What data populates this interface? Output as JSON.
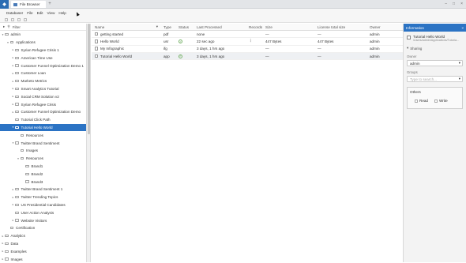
{
  "titlebar": {
    "tab_label": "File Browser",
    "add_tab": "+",
    "minimize": "–",
    "maximize": "□",
    "close": "×"
  },
  "menu": [
    "Databaser",
    "File",
    "Edit",
    "View",
    "Help"
  ],
  "tree": {
    "filter_label": "Filter",
    "rows": [
      {
        "label": "admin",
        "indent": 0,
        "arrow": "▾",
        "selected": false
      },
      {
        "label": "Applications",
        "indent": 1,
        "arrow": "▾",
        "selected": false
      },
      {
        "label": "Syrian Refugee Crisis 1",
        "indent": 2,
        "arrow": "▸",
        "selected": false
      },
      {
        "label": "American Time Use",
        "indent": 2,
        "arrow": "▸",
        "selected": false
      },
      {
        "label": "Customer Funnel Optimization Demo 1",
        "indent": 2,
        "arrow": "▸",
        "selected": false
      },
      {
        "label": "Customer Loan",
        "indent": 2,
        "arrow": "▸",
        "selected": false
      },
      {
        "label": "Marketo Metrics",
        "indent": 2,
        "arrow": "▸",
        "selected": false
      },
      {
        "label": "Smart Analytics Tutorial",
        "indent": 2,
        "arrow": "▸",
        "selected": false
      },
      {
        "label": "Social CRM Solution v2",
        "indent": 2,
        "arrow": "▸",
        "selected": false
      },
      {
        "label": "Syrian Refugee Crisis",
        "indent": 2,
        "arrow": "▸",
        "selected": false
      },
      {
        "label": "Customer Funnel Optimization Demo",
        "indent": 2,
        "arrow": "▸",
        "selected": false
      },
      {
        "label": "Tutorial Click Path",
        "indent": 2,
        "arrow": "",
        "selected": false
      },
      {
        "label": "Tutorial Hello World",
        "indent": 2,
        "arrow": "▾",
        "selected": true
      },
      {
        "label": "Resources",
        "indent": 3,
        "arrow": "",
        "selected": false
      },
      {
        "label": "Twitter Brand Sentiment",
        "indent": 2,
        "arrow": "▾",
        "selected": false
      },
      {
        "label": "Images",
        "indent": 3,
        "arrow": "",
        "selected": false
      },
      {
        "label": "Resources",
        "indent": 3,
        "arrow": "▾",
        "selected": false
      },
      {
        "label": "Brand1",
        "indent": 4,
        "arrow": "",
        "selected": false
      },
      {
        "label": "Brand2",
        "indent": 4,
        "arrow": "",
        "selected": false
      },
      {
        "label": "Brand3",
        "indent": 4,
        "arrow": "",
        "selected": false
      },
      {
        "label": "Twitter Brand Sentiment 1",
        "indent": 2,
        "arrow": "▸",
        "selected": false
      },
      {
        "label": "Twitter Trending Topics",
        "indent": 2,
        "arrow": "▸",
        "selected": false
      },
      {
        "label": "US Presidential Candidates",
        "indent": 2,
        "arrow": "▸",
        "selected": false
      },
      {
        "label": "User Action Analysis",
        "indent": 2,
        "arrow": "",
        "selected": false
      },
      {
        "label": "Website Visitors",
        "indent": 2,
        "arrow": "▸",
        "selected": false
      },
      {
        "label": "Certification",
        "indent": 1,
        "arrow": "",
        "selected": false
      },
      {
        "label": "Analytics",
        "indent": 0,
        "arrow": "▸",
        "selected": false
      },
      {
        "label": "Data",
        "indent": 0,
        "arrow": "▸",
        "selected": false
      },
      {
        "label": "Examples",
        "indent": 0,
        "arrow": "▸",
        "selected": false
      },
      {
        "label": "Images",
        "indent": 0,
        "arrow": "▸",
        "selected": false
      }
    ]
  },
  "table": {
    "headers": {
      "name": "Name",
      "sort": "▾",
      "type": "Type",
      "status": "Status",
      "last": "Last Processed",
      "records": "Records",
      "size": "Size",
      "license": "License total size",
      "owner": "Owner"
    },
    "rows": [
      {
        "name": "getting started",
        "type": "pdf",
        "status": "",
        "last": "none",
        "records": "",
        "size": "—",
        "license": "—",
        "owner": "admin",
        "highlight": false
      },
      {
        "name": "Hello World",
        "type": "usr",
        "status": "ok",
        "last": "22 sec ago",
        "records": "⋮",
        "size": "447 Bytes",
        "license": "447 Bytes",
        "owner": "admin",
        "highlight": false
      },
      {
        "name": "My Infographic",
        "type": "ifg",
        "status": "",
        "last": "3 days, 1 hrs ago",
        "records": "",
        "size": "—",
        "license": "—",
        "owner": "admin",
        "highlight": false
      },
      {
        "name": "Tutorial Hello World",
        "type": "app",
        "status": "ok",
        "last": "3 days, 1 hrs ago",
        "records": "",
        "size": "—",
        "license": "—",
        "owner": "admin",
        "highlight": true
      }
    ]
  },
  "info": {
    "header": "Information",
    "close": "×",
    "name": "Tutorial Hello World",
    "path": "/Users/admin/Applications/Tutoria...",
    "sharing_label": "Sharing",
    "owner_label": "Owner",
    "owner_value": "admin",
    "groups_label": "Groups",
    "groups_placeholder": "Type to search...",
    "others_label": "Others",
    "read_label": "Read",
    "write_label": "Write",
    "dropdown": "▾"
  }
}
